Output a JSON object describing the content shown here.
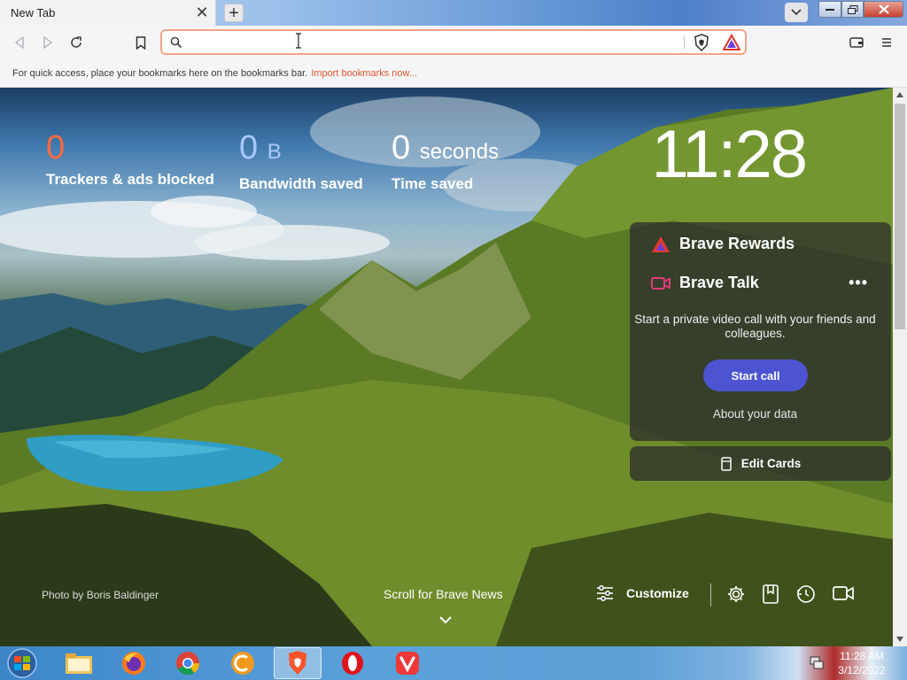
{
  "tab": {
    "title": "New Tab"
  },
  "urlbar": {
    "placeholder": "",
    "value": ""
  },
  "bookmarks_bar": {
    "message": "For quick access, place your bookmarks here on the bookmarks bar.",
    "link": "Import bookmarks now..."
  },
  "stats": {
    "trackers": {
      "value": "0",
      "label": "Trackers & ads blocked"
    },
    "bandwidth": {
      "value": "0",
      "unit": "B",
      "label": "Bandwidth saved"
    },
    "time": {
      "value": "0",
      "unit": "seconds",
      "label": "Time saved"
    }
  },
  "clock": "11:28",
  "cards": {
    "rewards_title": "Brave Rewards",
    "talk_title": "Brave Talk",
    "menu": "•••",
    "talk_description": "Start a private video call with your friends and colleagues.",
    "start_call": "Start call",
    "about_data": "About your data",
    "edit_cards": "Edit Cards"
  },
  "footer": {
    "photo_credit": "Photo by Boris Baldinger",
    "scroll_news": "Scroll for Brave News",
    "customize": "Customize"
  },
  "icons": {
    "bottom": [
      "settings-icon",
      "bookmarks-icon",
      "history-icon",
      "brave-talk-icon"
    ]
  },
  "taskbar": {
    "apps": [
      "file-explorer-icon",
      "firefox-icon",
      "chrome-icon",
      "ccleaner-icon",
      "brave-icon",
      "opera-icon",
      "vivaldi-icon"
    ],
    "time": "11:28 AM",
    "date": "3/12/2022"
  },
  "colors": {
    "accent_orange": "#ff6a3d",
    "start_call_button": "#4c54d2",
    "bandwidth_blue": "#a9c8ff"
  }
}
